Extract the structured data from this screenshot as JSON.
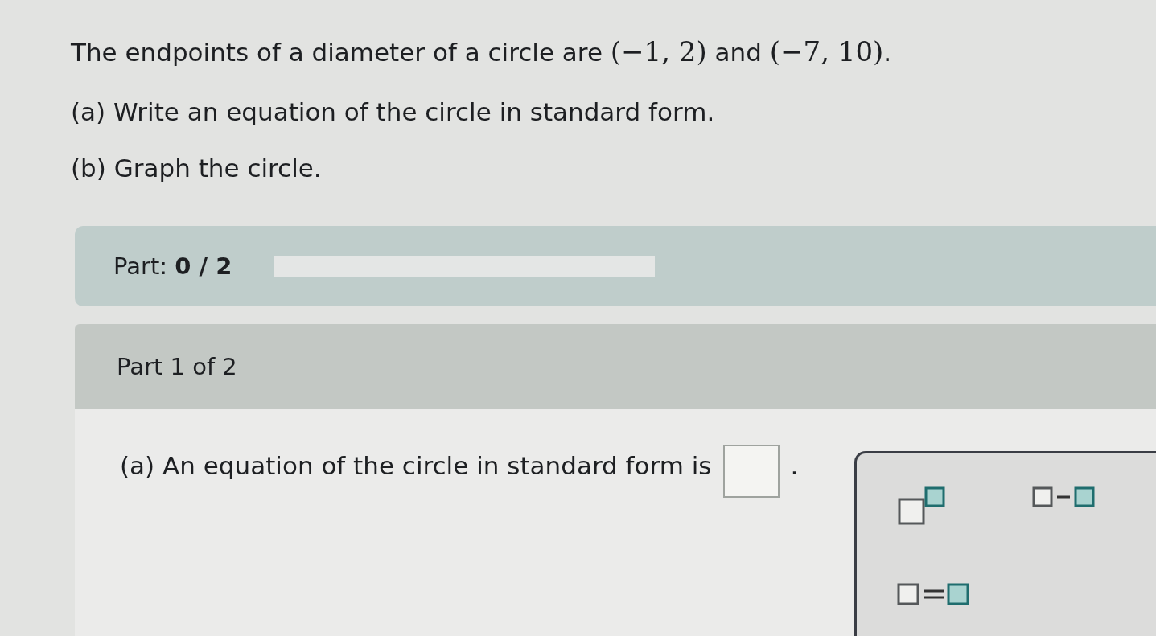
{
  "question": {
    "segments": [
      {
        "kind": "text",
        "text": "The endpoints of a diameter of a circle are "
      },
      {
        "kind": "math",
        "text": "(−1, 2)"
      },
      {
        "kind": "text",
        "text": " and "
      },
      {
        "kind": "math",
        "text": "(−7, 10)"
      },
      {
        "kind": "text",
        "text": "."
      }
    ],
    "items": [
      "(a) Write an equation of the circle in standard form.",
      "(b) Graph the circle."
    ]
  },
  "progress": {
    "label": "Part:",
    "value": "0 / 2",
    "level": 0
  },
  "part": {
    "title": "Part 1 of 2",
    "prompt": "(a) An equation of the circle in standard form is",
    "end": "."
  },
  "palette": [
    {
      "kind": "superscript"
    },
    {
      "kind": "subtract"
    },
    {
      "kind": "equals"
    }
  ]
}
